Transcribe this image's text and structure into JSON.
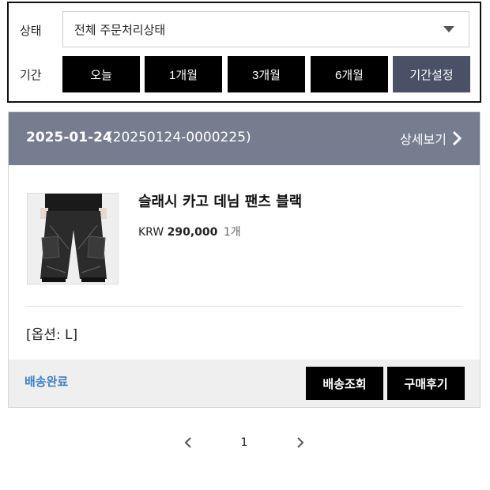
{
  "filter": {
    "status_label": "상태",
    "status_value": "전체 주문처리상태",
    "period_label": "기간",
    "period_buttons": [
      "오늘",
      "1개월",
      "3개월",
      "6개월",
      "기간설정"
    ]
  },
  "order": {
    "date": "2025-01-24",
    "order_no": "(20250124-0000225)",
    "detail_label": "상세보기",
    "product": {
      "name": "슬래시 카고 데님 팬츠 블랙",
      "currency": "KRW",
      "price": "290,000",
      "qty": "1개",
      "option": "[옵션: L]"
    },
    "delivery_status": "배송완료",
    "track_button": "배송조회",
    "review_button": "구매후기"
  },
  "pagination": {
    "current_page": "1"
  },
  "colors": {
    "header_bg": "#767d8e",
    "custom_period_bg": "#4a5066",
    "status_text": "#3d7fc3",
    "button_bg": "#000000"
  }
}
